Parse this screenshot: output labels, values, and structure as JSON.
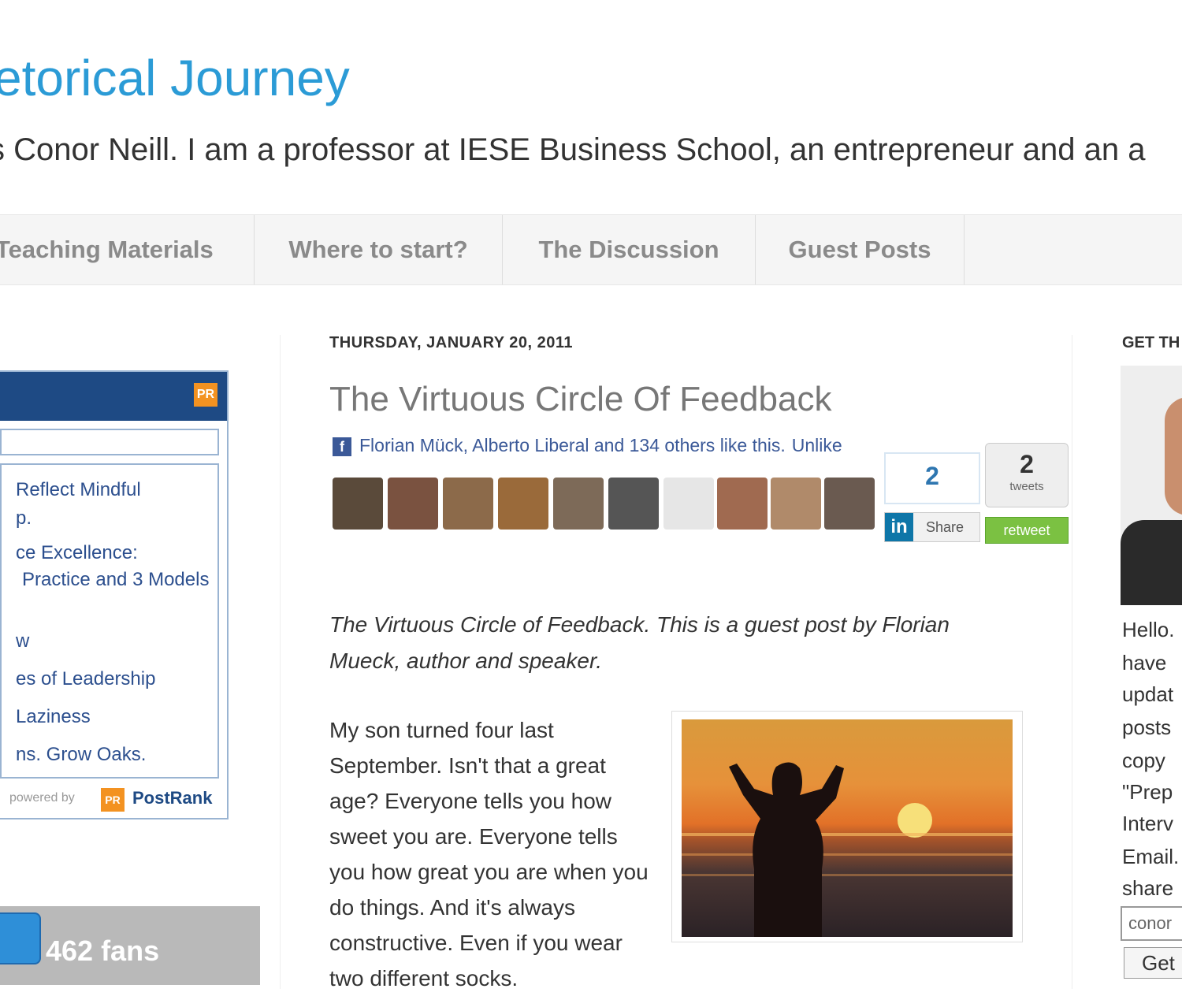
{
  "header": {
    "title": "etorical Journey",
    "description": "s Conor Neill. I am a professor at IESE Business School, an entrepreneur and an a"
  },
  "nav": {
    "tabs": [
      "Teaching Materials",
      "Where to start?",
      "The Discussion",
      "Guest Posts"
    ]
  },
  "left_sidebar": {
    "postrank": {
      "items": [
        "Reflect Mindful",
        "p.",
        "ce Excellence:",
        "Practice and 3 Models",
        "w",
        "es of Leadership",
        "Laziness",
        "ns. Grow Oaks."
      ],
      "powered_by": "powered by",
      "logo_text": "PostRank",
      "rss_icon_label": "PR",
      "logo_icon_label": "PR"
    },
    "fans": {
      "label": "462 fans"
    }
  },
  "post": {
    "date": "THURSDAY, JANUARY 20, 2011",
    "title": "The Virtuous Circle Of Feedback",
    "facebook": {
      "icon_label": "f",
      "text": "Florian Mück, Alberto Liberal and 134 others like this.",
      "unlike": "Unlike"
    },
    "linkedin": {
      "count": "2",
      "logo": "in",
      "label": "Share"
    },
    "twitter": {
      "count": "2",
      "unit": "tweets",
      "label": "retweet"
    },
    "intro": "The Virtuous Circle of Feedback. This is a guest post by Florian Mueck, author and speaker.",
    "paragraph": "My son turned four last September. Isn't that a great age? Everyone tells you how sweet you are. Everyone tells you how great you are when you do things. And it's always constructive. Even if you wear two different socks."
  },
  "right_sidebar": {
    "heading": "GET TH",
    "lines": [
      "Hello.",
      "have",
      "updat",
      "posts",
      "copy",
      "\"Prep",
      "Interv",
      "Email.",
      "share"
    ],
    "email_placeholder": "conor",
    "button": "Get"
  },
  "icons": {
    "rss": "rss-icon",
    "facebook": "facebook-icon",
    "linkedin": "linkedin-icon",
    "fans": "fans-icon"
  }
}
